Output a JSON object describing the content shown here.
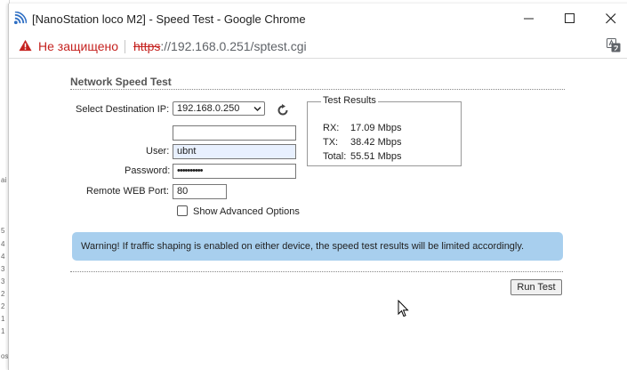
{
  "background": {
    "left_strip_glyphs": [
      "ai",
      "5",
      "4",
      "4",
      "3",
      "3",
      "2",
      "2",
      "1",
      "1",
      "os"
    ]
  },
  "window": {
    "title": "[NanoStation loco M2] - Speed Test - Google Chrome",
    "controls": [
      "minimize",
      "maximize",
      "close"
    ]
  },
  "address_bar": {
    "security_text": "Не защищено",
    "url_scheme": "https",
    "url_rest": "://192.168.0.251/sptest.cgi"
  },
  "form": {
    "section_title": "Network Speed Test",
    "destination_label": "Select Destination IP:",
    "destination_value": "192.168.0.250",
    "custom_ip_value": "",
    "user_label": "User:",
    "user_value": "ubnt",
    "password_label": "Password:",
    "password_value": "••••••••••",
    "port_label": "Remote WEB Port:",
    "port_value": "80",
    "advanced_label": "Show Advanced Options",
    "advanced_checked": false
  },
  "results": {
    "legend": "Test Results",
    "rx_label": "RX:",
    "rx_value": "17.09 Mbps",
    "tx_label": "TX:",
    "tx_value": "38.42 Mbps",
    "total_label": "Total:",
    "total_value": "55.51 Mbps"
  },
  "warning_text": "Warning! If traffic shaping is enabled on either device, the speed test results will be limited accordingly.",
  "run_button_label": "Run Test",
  "colors": {
    "warning_bg": "#a8cfee",
    "insecure_red": "#c5221f",
    "favicon_blue": "#2f6fc4"
  }
}
